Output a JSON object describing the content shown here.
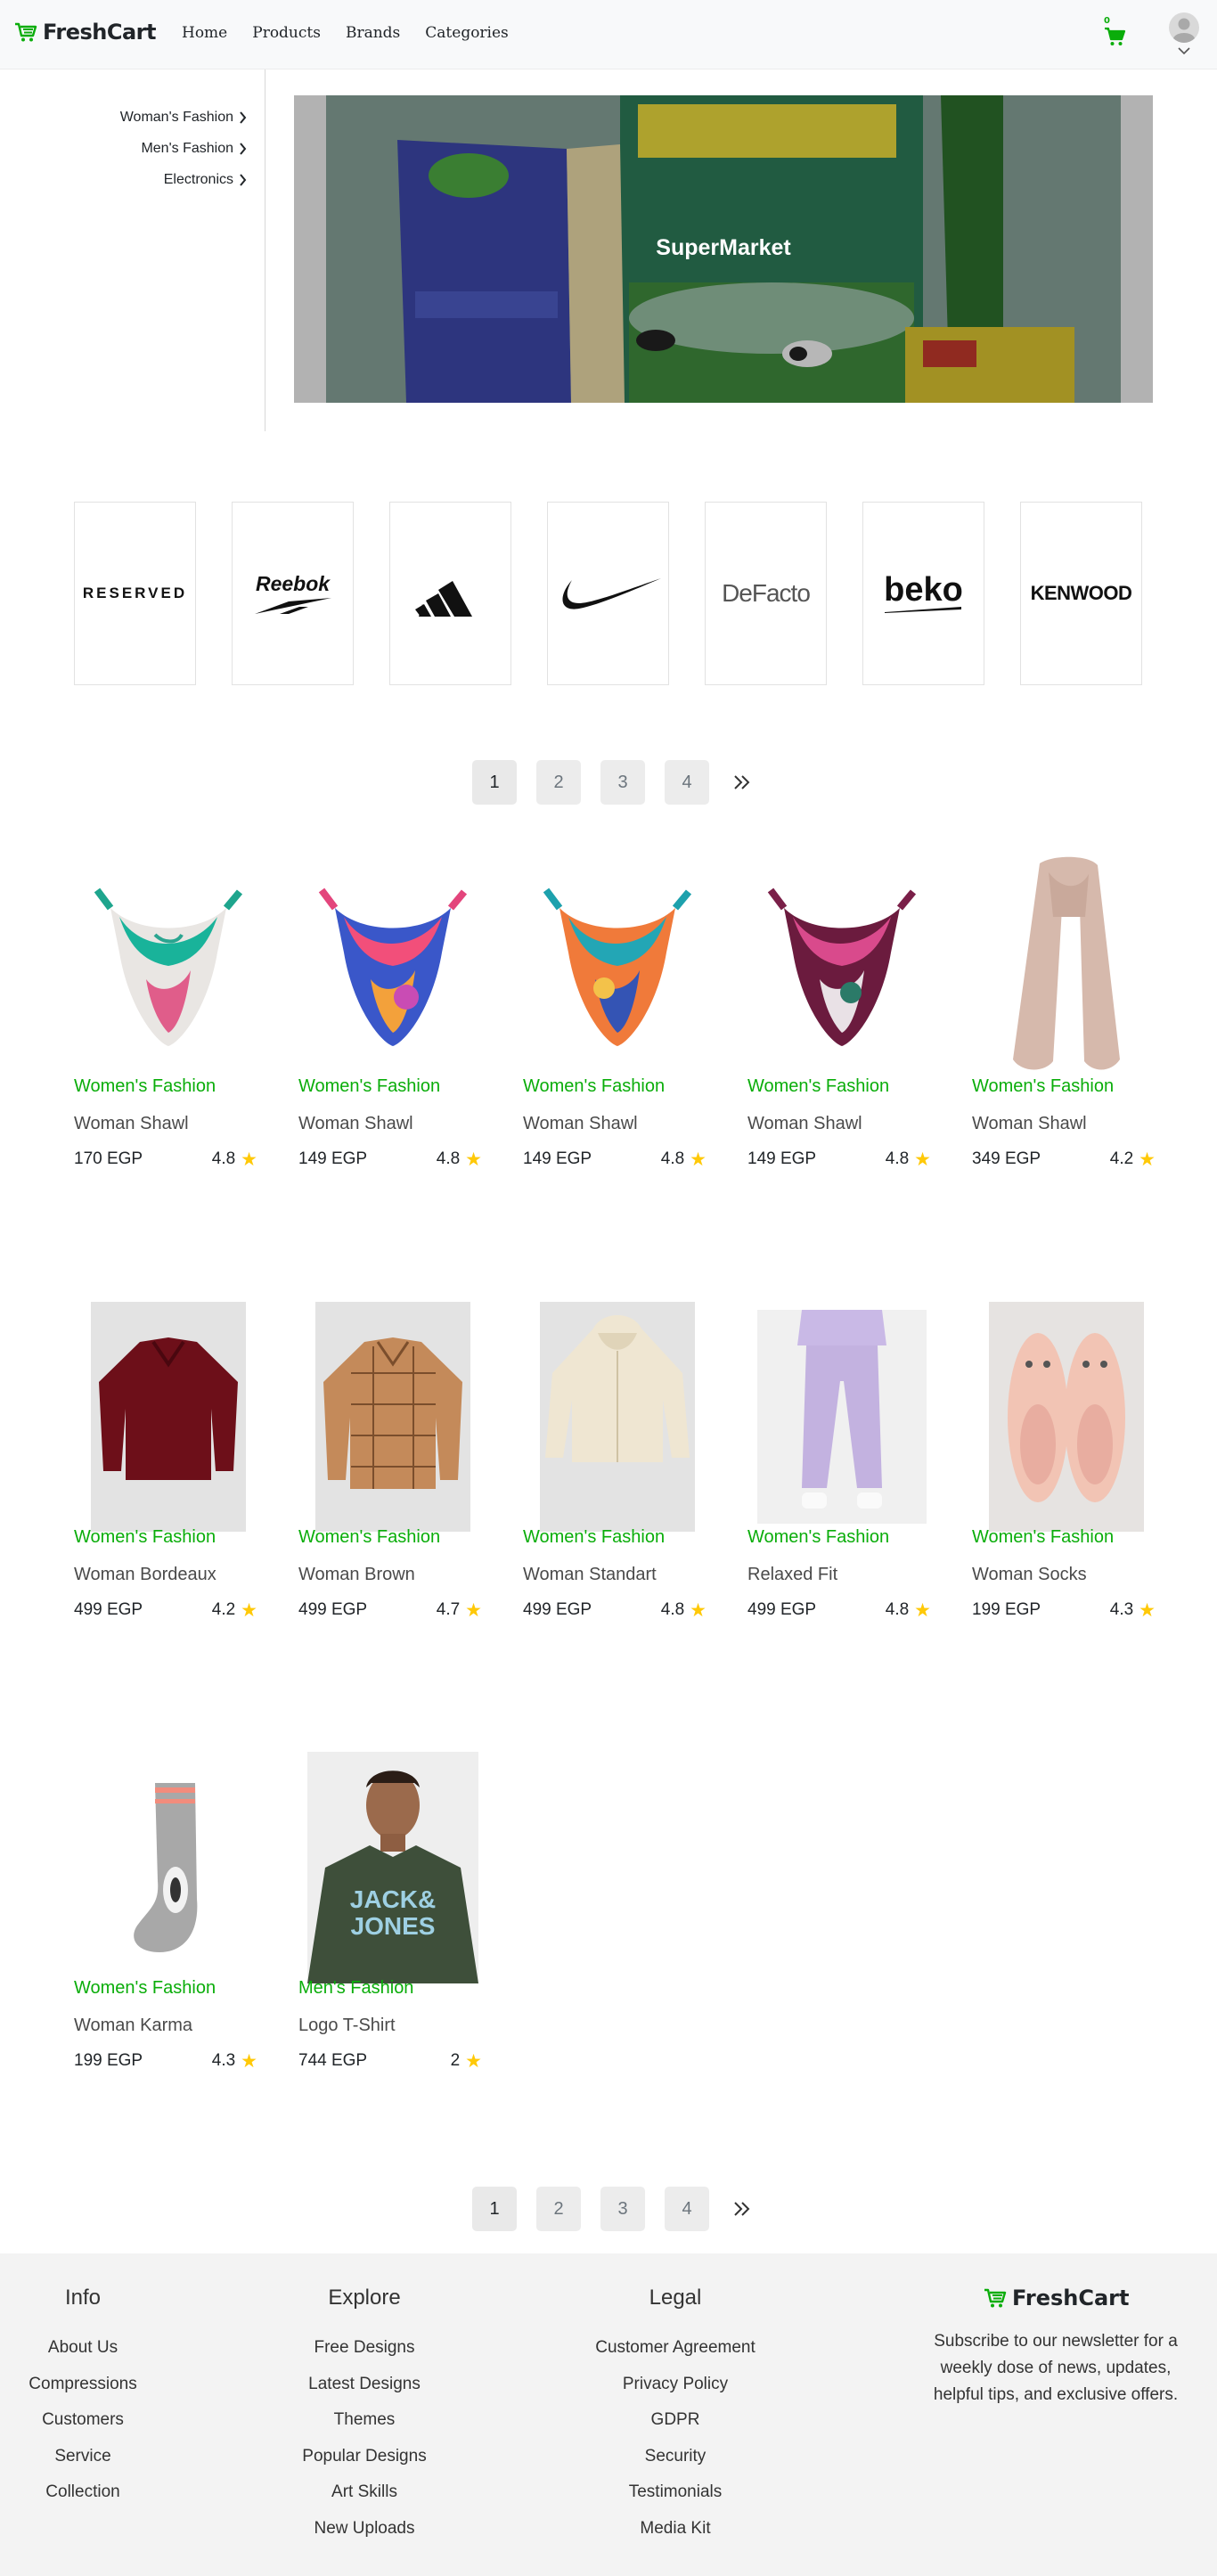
{
  "navbar": {
    "brand": "FreshCart",
    "links": [
      "Home",
      "Products",
      "Brands",
      "Categories"
    ],
    "cart_count": "0",
    "accent_color": "#0aad0a"
  },
  "sidebar_categories": [
    "Woman's Fashion",
    "Men's Fashion",
    "Electronics"
  ],
  "hero": {
    "caption": "SuperMarket"
  },
  "brands": [
    {
      "name": "reserved-logo",
      "text": "RESERVED"
    },
    {
      "name": "reebok-logo",
      "text": "Reebok"
    },
    {
      "name": "adidas-logo",
      "text": ""
    },
    {
      "name": "nike-logo",
      "text": ""
    },
    {
      "name": "defacto-logo",
      "text": "DeFacto"
    },
    {
      "name": "beko-logo",
      "text": "beko"
    },
    {
      "name": "kenwood-logo",
      "text": "KENWOOD"
    }
  ],
  "pagination": {
    "pages": [
      "1",
      "2",
      "3",
      "4"
    ],
    "active": "1",
    "next_icon": "double-chevron-right-icon"
  },
  "products": [
    {
      "category": "Women's Fashion",
      "title": "Woman Shawl",
      "price": "170 EGP",
      "rating": "4.8"
    },
    {
      "category": "Women's Fashion",
      "title": "Woman Shawl",
      "price": "149 EGP",
      "rating": "4.8"
    },
    {
      "category": "Women's Fashion",
      "title": "Woman Shawl",
      "price": "149 EGP",
      "rating": "4.8"
    },
    {
      "category": "Women's Fashion",
      "title": "Woman Shawl",
      "price": "149 EGP",
      "rating": "4.8"
    },
    {
      "category": "Women's Fashion",
      "title": "Woman Shawl",
      "price": "349 EGP",
      "rating": "4.2"
    },
    {
      "category": "Women's Fashion",
      "title": "Woman Bordeaux",
      "price": "499 EGP",
      "rating": "4.2"
    },
    {
      "category": "Women's Fashion",
      "title": "Woman Brown",
      "price": "499 EGP",
      "rating": "4.7"
    },
    {
      "category": "Women's Fashion",
      "title": "Woman Standart",
      "price": "499 EGP",
      "rating": "4.8"
    },
    {
      "category": "Women's Fashion",
      "title": "Relaxed Fit",
      "price": "499 EGP",
      "rating": "4.8"
    },
    {
      "category": "Women's Fashion",
      "title": "Woman Socks",
      "price": "199 EGP",
      "rating": "4.3"
    },
    {
      "category": "Women's Fashion",
      "title": "Woman Karma",
      "price": "199 EGP",
      "rating": "4.3"
    },
    {
      "category": "Men's Fashion",
      "title": "Logo T-Shirt",
      "price": "744 EGP",
      "rating": "2"
    }
  ],
  "footer": {
    "info": {
      "heading": "Info",
      "links": [
        "About Us",
        "Compressions",
        "Customers",
        "Service",
        "Collection"
      ]
    },
    "explore": {
      "heading": "Explore",
      "links": [
        "Free Designs",
        "Latest Designs",
        "Themes",
        "Popular Designs",
        "Art Skills",
        "New Uploads"
      ]
    },
    "legal": {
      "heading": "Legal",
      "links": [
        "Customer Agreement",
        "Privacy Policy",
        "GDPR",
        "Security",
        "Testimonials",
        "Media Kit"
      ]
    },
    "brand": "FreshCart",
    "subscribe_text": "Subscribe to our newsletter for a weekly dose of news, updates, helpful tips, and exclusive offers."
  }
}
